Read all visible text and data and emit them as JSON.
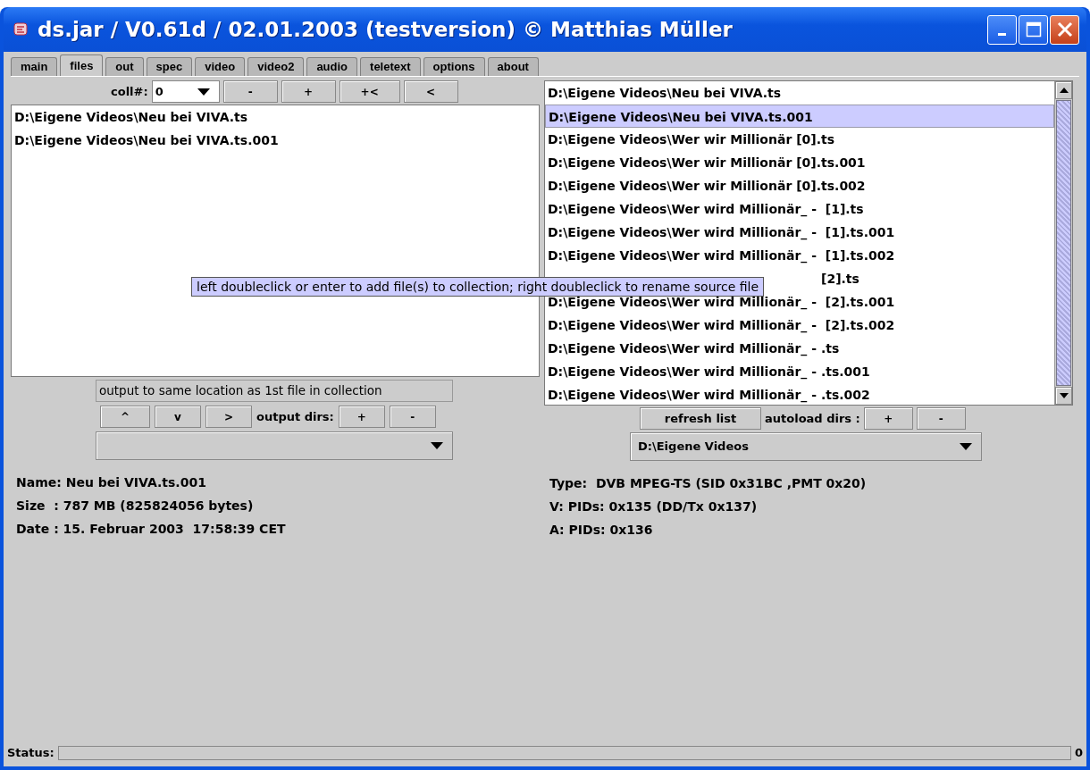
{
  "window": {
    "title": "ds.jar / V0.61d / 02.01.2003 (testversion) © Matthias Müller"
  },
  "tabs": [
    {
      "label": "main",
      "selected": false
    },
    {
      "label": "files",
      "selected": true
    },
    {
      "label": "out",
      "selected": false
    },
    {
      "label": "spec",
      "selected": false
    },
    {
      "label": "video",
      "selected": false
    },
    {
      "label": "video2",
      "selected": false
    },
    {
      "label": "audio",
      "selected": false
    },
    {
      "label": "teletext",
      "selected": false
    },
    {
      "label": "options",
      "selected": false
    },
    {
      "label": "about",
      "selected": false
    }
  ],
  "collection": {
    "label": "coll#:",
    "value": "0",
    "buttons": [
      "-",
      "+",
      "+<",
      "<"
    ],
    "files": [
      "D:\\Eigene Videos\\Neu bei VIVA.ts",
      "D:\\Eigene Videos\\Neu bei VIVA.ts.001"
    ],
    "output_note": "output to same location as 1st file in collection",
    "move_buttons": [
      "^",
      "v",
      ">"
    ],
    "output_dirs_label": "output dirs:",
    "output_dirs_buttons": [
      "+",
      "-"
    ]
  },
  "info_left": [
    "Name: Neu bei VIVA.ts.001",
    "Size  : 787 MB (825824056 bytes)",
    "Date : 15. Februar 2003  17:58:39 CET"
  ],
  "source_list": {
    "files": [
      {
        "text": "D:\\Eigene Videos\\Neu bei VIVA.ts",
        "selected": false
      },
      {
        "text": "D:\\Eigene Videos\\Neu bei VIVA.ts.001",
        "selected": true
      },
      {
        "text": "D:\\Eigene Videos\\Wer wir Millionär [0].ts",
        "selected": false
      },
      {
        "text": "D:\\Eigene Videos\\Wer wir Millionär [0].ts.001",
        "selected": false
      },
      {
        "text": "D:\\Eigene Videos\\Wer wir Millionär [0].ts.002",
        "selected": false
      },
      {
        "text": "D:\\Eigene Videos\\Wer wird Millionär_ -  [1].ts",
        "selected": false
      },
      {
        "text": "D:\\Eigene Videos\\Wer wird Millionär_ -  [1].ts.001",
        "selected": false
      },
      {
        "text": "D:\\Eigene Videos\\Wer wird Millionär_ -  [1].ts.002",
        "selected": false
      },
      {
        "text": "[2].ts",
        "selected": false,
        "kind": "partly-hidden"
      },
      {
        "text": "D:\\Eigene Videos\\Wer wird Millionär_ -  [2].ts.001",
        "selected": false
      },
      {
        "text": "D:\\Eigene Videos\\Wer wird Millionär_ -  [2].ts.002",
        "selected": false
      },
      {
        "text": "D:\\Eigene Videos\\Wer wird Millionär_ - .ts",
        "selected": false
      },
      {
        "text": "D:\\Eigene Videos\\Wer wird Millionär_ - .ts.001",
        "selected": false
      },
      {
        "text": "D:\\Eigene Videos\\Wer wird Millionär_ - .ts.002",
        "selected": false
      }
    ],
    "refresh_button": "refresh list",
    "autoload_label": "autoload dirs :",
    "autoload_buttons": [
      "+",
      "-"
    ],
    "autoload_value": "D:\\Eigene Videos"
  },
  "info_right": [
    "Type:  DVB MPEG-TS (SID 0x31BC ,PMT 0x20)",
    "V: PIDs: 0x135 (DD/Tx 0x137)",
    "A: PIDs: 0x136"
  ],
  "tooltip": "left doubleclick or enter to add file(s) to collection; right doubleclick to rename source file",
  "status_bar": {
    "label": "Status:",
    "level": 0,
    "value": "0"
  }
}
